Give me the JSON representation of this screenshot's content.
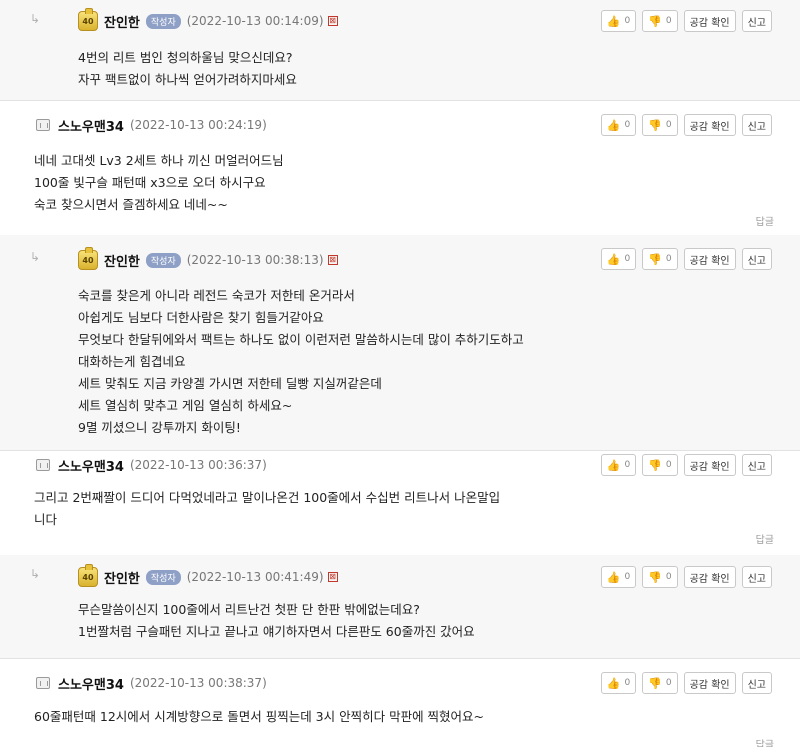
{
  "labels": {
    "like_count": "0",
    "dislike_count": "0",
    "agree_check": "공감 확인",
    "report": "신고",
    "reply": "답글",
    "author_tag": "작성자",
    "level_badge": "40",
    "reply_arrow": "↳",
    "report_mark": "⊠"
  },
  "icons": {
    "like": "thumb-up-icon",
    "dislike": "thumb-down-icon",
    "level": "level-badge-icon",
    "user": "user-icon"
  },
  "colors": {
    "reply_bg": "#f7f7f7",
    "author_tag_bg": "#8fa0c7",
    "like_color": "#d9402b",
    "level_gold": "#d9b22e"
  },
  "comments": [
    {
      "type": "reply",
      "nickname": "잔인한",
      "is_author": true,
      "date": "(2022-10-13 00:14:09)",
      "text": "4번의 리트 범인 청의하울님 맞으신데요?\n자꾸 팩트없이 하나씩 얻어가려하지마세요"
    },
    {
      "type": "top",
      "nickname": "스노우맨34",
      "is_author": false,
      "date": "(2022-10-13 00:24:19)",
      "text": "네네 고대셋 Lv3 2세트 하나 끼신 머얼러어드님\n100줄 빛구슬 패턴때 x3으로 오더 하시구요\n숙코 찾으시면서 즐겜하세요 네네~~"
    },
    {
      "type": "reply",
      "nickname": "잔인한",
      "is_author": true,
      "date": "(2022-10-13 00:38:13)",
      "text": "숙코를 찾은게 아니라 레전드 숙코가 저한테 온거라서\n아쉽게도 님보다 더한사람은 찾기 힘들거같아요\n무엇보다 한달뒤에와서 팩트는 하나도 없이 이런저런 말씀하시는데 많이 추하기도하고\n대화하는게 힘겹네요\n세트 맞춰도 지금 카양겔 가시면 저한테 딜빵 지실꺼같은데\n세트 열심히 맞추고 게임 열심히 하세요~\n9멸 끼셨으니 강투까지 화이팅!"
    },
    {
      "type": "top",
      "nickname": "스노우맨34",
      "is_author": false,
      "date": "(2022-10-13 00:36:37)",
      "text": "그리고 2번째짤이 드디어 다먹었네라고 말이나온건 100줄에서 수십번 리트나서 나온말입\n니다"
    },
    {
      "type": "reply",
      "nickname": "잔인한",
      "is_author": true,
      "date": "(2022-10-13 00:41:49)",
      "text": "무슨말씀이신지 100줄에서 리트난건 첫판 단 한판 밖에없는데요?\n1번짤처럼 구슬패턴 지나고 끝나고 얘기하자면서 다른판도 60줄까진 갔어요"
    },
    {
      "type": "top",
      "nickname": "스노우맨34",
      "is_author": false,
      "date": "(2022-10-13 00:38:37)",
      "text": "60줄패턴때 12시에서 시계방향으로 돌면서 핑찍는데 3시 안찍히다 막판에 찍혔어요~"
    }
  ]
}
